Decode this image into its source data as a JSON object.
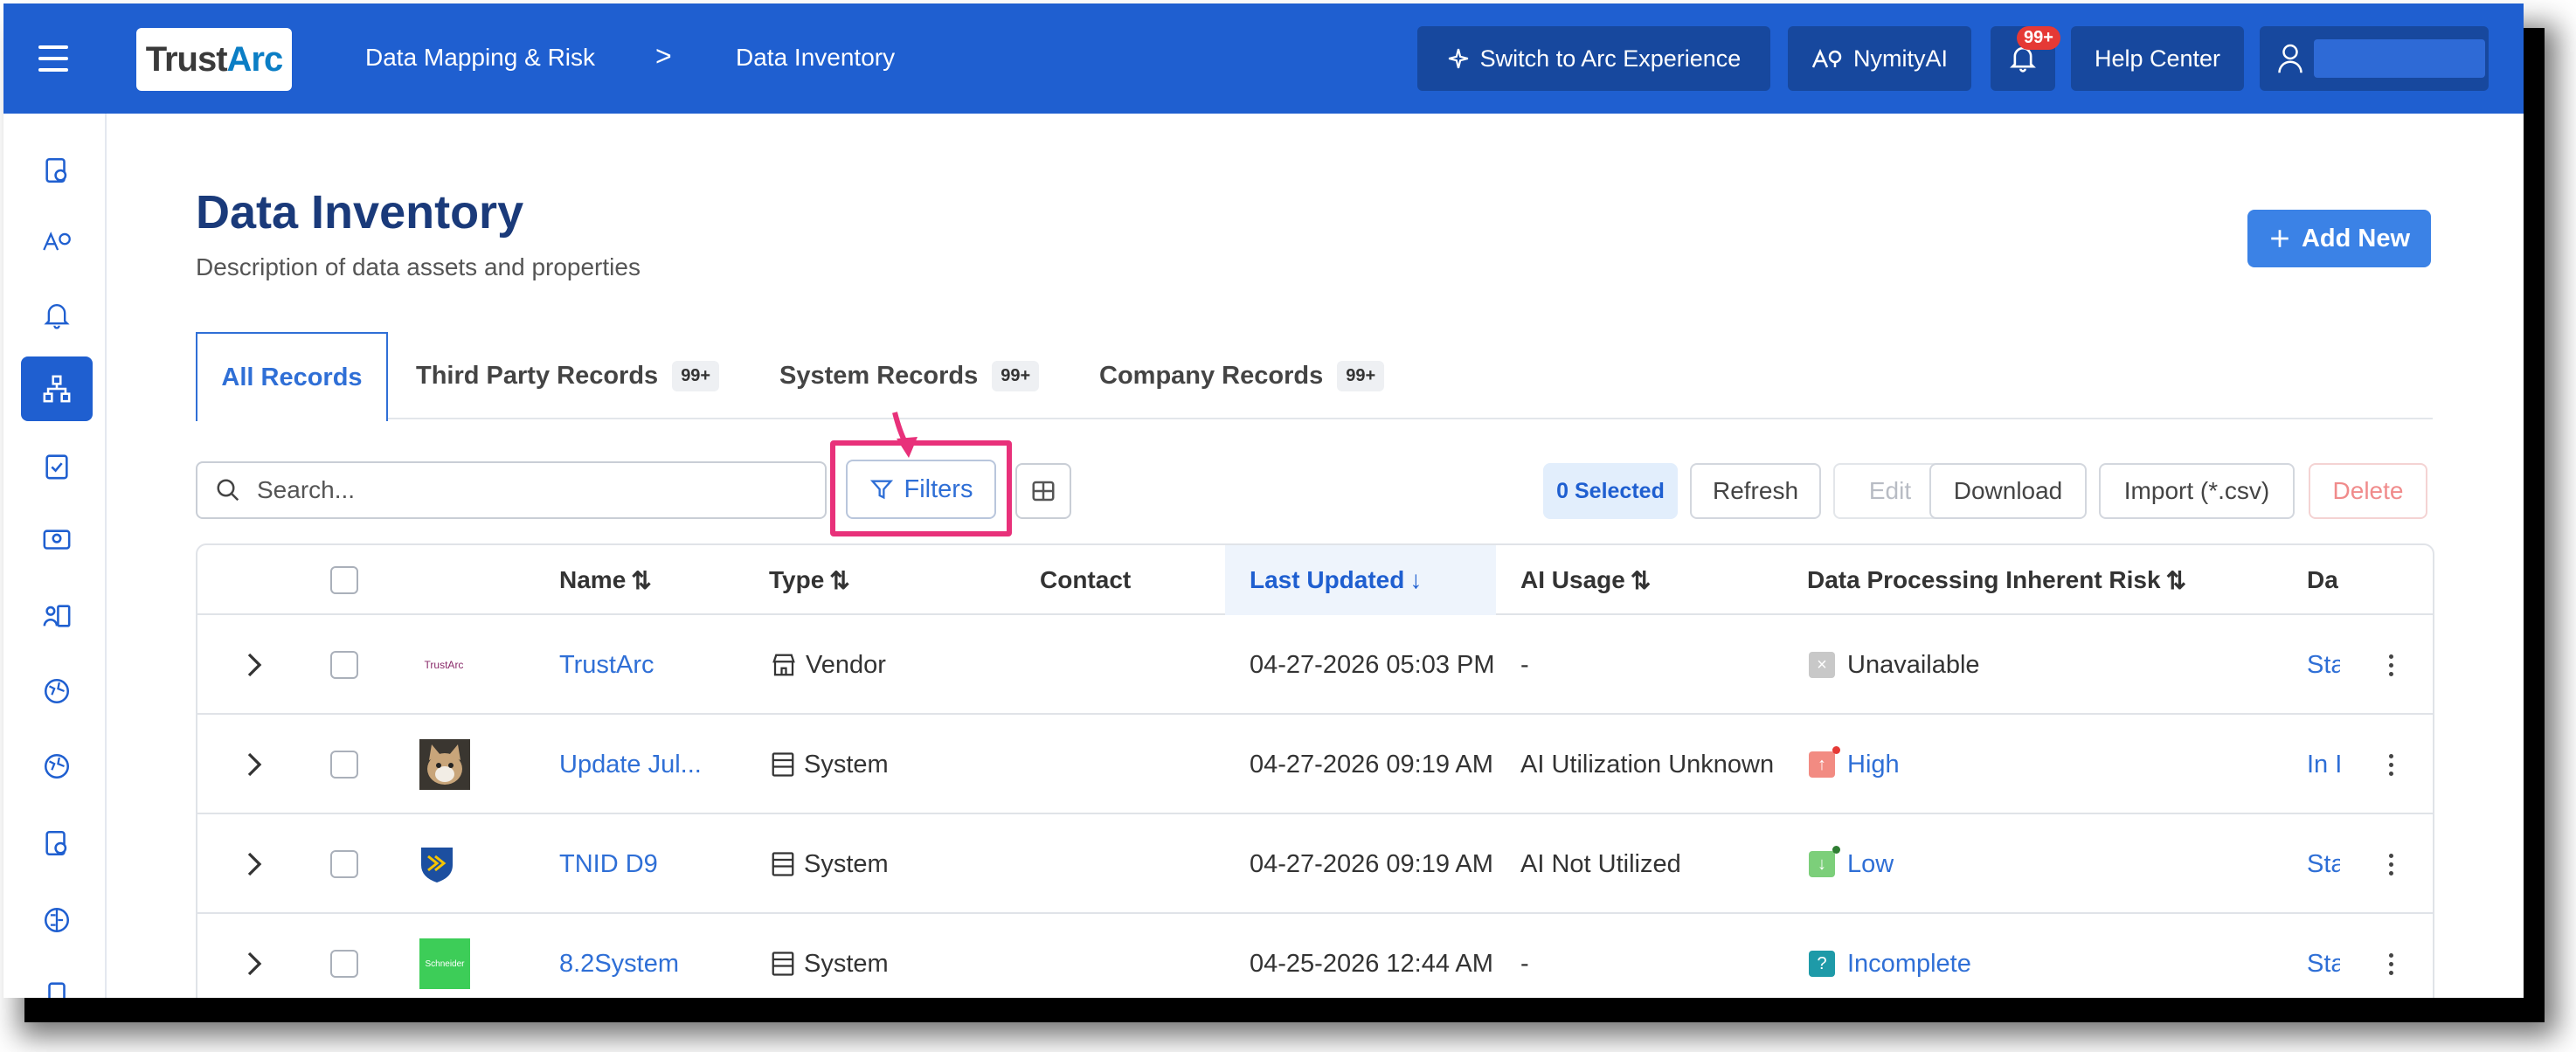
{
  "header": {
    "breadcrumb_1": "Data Mapping & Risk",
    "breadcrumb_sep": ">",
    "breadcrumb_2": "Data Inventory",
    "switch_label": "Switch to Arc Experience",
    "nymity_label": "NymityAI",
    "notifications_badge": "99+",
    "help_label": "Help Center",
    "logo_trust": "Trust",
    "logo_arc": "Arc"
  },
  "page": {
    "title": "Data Inventory",
    "subtitle": "Description of data assets and properties",
    "add_new": "Add New"
  },
  "tabs": [
    {
      "label": "All Records",
      "count": ""
    },
    {
      "label": "Third Party Records",
      "count": "99+"
    },
    {
      "label": "System Records",
      "count": "99+"
    },
    {
      "label": "Company Records",
      "count": "99+"
    }
  ],
  "toolbar": {
    "search_placeholder": "Search...",
    "filters": "Filters",
    "selected": "0 Selected",
    "refresh": "Refresh",
    "edit": "Edit",
    "download": "Download",
    "import": "Import (*.csv)",
    "delete": "Delete"
  },
  "table": {
    "headers": {
      "name": "Name",
      "type": "Type",
      "contact": "Contact",
      "last_updated": "Last Updated",
      "ai_usage": "AI Usage",
      "risk": "Data Processing Inherent Risk",
      "da": "Da"
    },
    "rows": [
      {
        "name": "TrustArc",
        "type": "Vendor",
        "contact": "",
        "updated": "04-27-2026 05:03 PM",
        "ai": "-",
        "risk": "Unavailable",
        "status": "Sta",
        "logo_text": "TrustArc"
      },
      {
        "name": "Update Jul...",
        "type": "System",
        "contact": "",
        "updated": "04-27-2026 09:19 AM",
        "ai": "AI Utilization Unknown",
        "risk": "High",
        "status": "In I",
        "logo_text": ""
      },
      {
        "name": "TNID D9",
        "type": "System",
        "contact": "",
        "updated": "04-27-2026 09:19 AM",
        "ai": "AI Not Utilized",
        "risk": "Low",
        "status": "Sta",
        "logo_text": ""
      },
      {
        "name": "8.2System",
        "type": "System",
        "contact": "",
        "updated": "04-25-2026 12:44 AM",
        "ai": "-",
        "risk": "Incomplete",
        "status": "Sta",
        "logo_text": "Schneider"
      }
    ]
  },
  "colors": {
    "brand": "#1f5fd0",
    "highlight": "#e8317a",
    "risk_high": "#f28b82",
    "risk_low": "#7ccf7a",
    "risk_incomplete": "#1e9aa8",
    "risk_unavailable": "#c8c8c8"
  },
  "icons": {
    "sidebar": [
      "dashboard-icon",
      "nymity-icon",
      "bell-icon",
      "hierarchy-icon",
      "clipboard-icon",
      "monitor-icon",
      "contacts-icon",
      "globe-icon",
      "globe-icon",
      "badge-icon",
      "brain-icon"
    ]
  }
}
